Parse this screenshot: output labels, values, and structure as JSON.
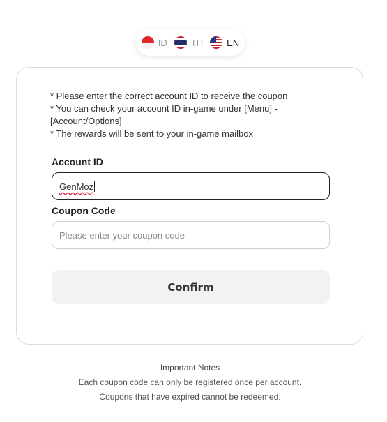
{
  "languages": [
    {
      "code": "ID",
      "flag": "indonesia-flag-icon",
      "active": false
    },
    {
      "code": "TH",
      "flag": "thailand-flag-icon",
      "active": false
    },
    {
      "code": "EN",
      "flag": "us-flag-icon",
      "active": true
    }
  ],
  "card": {
    "notes": [
      "* Please enter the correct account ID to receive the coupon",
      "* You can check your account ID in-game under [Menu] - [Account/Options]",
      "* The rewards will be sent to your in-game mailbox"
    ],
    "account_id": {
      "label": "Account ID",
      "value": "GenMoz"
    },
    "coupon_code": {
      "label": "Coupon Code",
      "placeholder": "Please enter your coupon code",
      "value": ""
    },
    "confirm_label": "Confirm"
  },
  "footer": {
    "title": "Important Notes",
    "lines": [
      "Each coupon code can only be registered once per account.",
      "Coupons that have expired cannot be redeemed."
    ]
  },
  "colors": {
    "border_active": "#222222",
    "border_default": "#cfcfcf",
    "button_bg": "#f2f2f2",
    "spellcheck_underline": "#dd2233"
  }
}
